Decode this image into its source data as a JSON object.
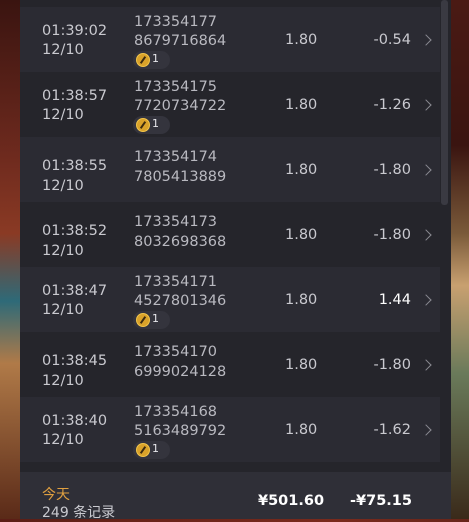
{
  "records": [
    {
      "time": "01:39:02",
      "date": "12/10",
      "id_line1": "173354177",
      "id_line2": "8679716864",
      "value": "1.80",
      "pnl": "-0.54",
      "badge": "1"
    },
    {
      "time": "01:38:57",
      "date": "12/10",
      "id_line1": "173354175",
      "id_line2": "7720734722",
      "value": "1.80",
      "pnl": "-1.26",
      "badge": "1"
    },
    {
      "time": "01:38:55",
      "date": "12/10",
      "id_line1": "173354174",
      "id_line2": "7805413889",
      "value": "1.80",
      "pnl": "-1.80",
      "badge": null
    },
    {
      "time": "01:38:52",
      "date": "12/10",
      "id_line1": "173354173",
      "id_line2": "8032698368",
      "value": "1.80",
      "pnl": "-1.80",
      "badge": null
    },
    {
      "time": "01:38:47",
      "date": "12/10",
      "id_line1": "173354171",
      "id_line2": "4527801346",
      "value": "1.80",
      "pnl": "1.44",
      "badge": "1"
    },
    {
      "time": "01:38:45",
      "date": "12/10",
      "id_line1": "173354170",
      "id_line2": "6999024128",
      "value": "1.80",
      "pnl": "-1.80",
      "badge": null
    },
    {
      "time": "01:38:40",
      "date": "12/10",
      "id_line1": "173354168",
      "id_line2": "5163489792",
      "value": "1.80",
      "pnl": "-1.62",
      "badge": "1"
    }
  ],
  "footer": {
    "label": "今天",
    "count": "249",
    "count_suffix": "条记录",
    "total": "¥501.60",
    "pnl": "-¥75.15"
  },
  "colors": {
    "panel_bg": "#25252b",
    "row_alt_bg": "#2b2b33",
    "accent_orange": "#e0a040",
    "badge_gold": "#d9a22a"
  },
  "icons": {
    "badge": "coin-icon",
    "row_action": "chevron-right-icon"
  }
}
